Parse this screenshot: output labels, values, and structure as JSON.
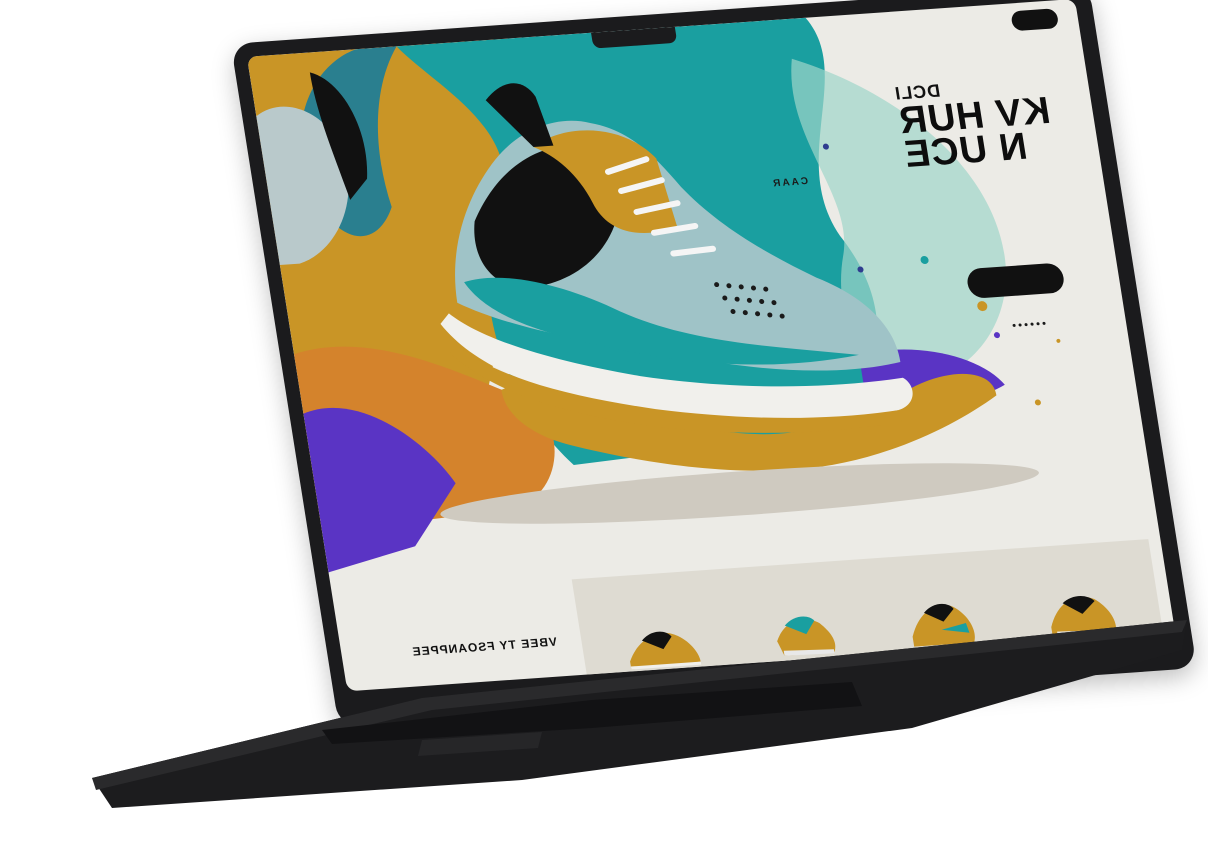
{
  "nav": {
    "items": [
      "",
      "",
      "",
      "",
      "",
      "",
      ""
    ],
    "cta_label": ""
  },
  "hero": {
    "kicker": "DCLI",
    "headline": "KV HUR\nN UCE",
    "side_label": "CAAR",
    "body_lines": [
      "",
      "",
      "",
      "",
      ""
    ],
    "cta_label": ""
  },
  "footer": {
    "title": "VBEE TY FSOANPPEE"
  },
  "colors": {
    "teal": "#1a9fa0",
    "mustard": "#c99526",
    "orange": "#d4832c",
    "purple": "#5a34c4",
    "black": "#111111",
    "screen_bg": "#ecebe6",
    "laptop": "#1b1b1d"
  },
  "icons": {
    "ports": [
      "usb-c-port-icon",
      "usb-c-port-icon",
      "headphone-jack-icon"
    ]
  }
}
